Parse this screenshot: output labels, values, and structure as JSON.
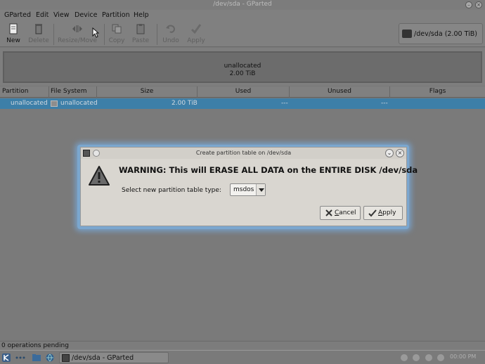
{
  "window": {
    "title": "/dev/sda - GParted"
  },
  "menubar": {
    "items": [
      {
        "label": "GParted"
      },
      {
        "label": "Edit"
      },
      {
        "label": "View"
      },
      {
        "label": "Device"
      },
      {
        "label": "Partition"
      },
      {
        "label": "Help"
      }
    ]
  },
  "toolbar": {
    "new_label": "New",
    "delete_label": "Delete",
    "resize_label": "Resize/Move",
    "copy_label": "Copy",
    "paste_label": "Paste",
    "undo_label": "Undo",
    "apply_label": "Apply",
    "device": "/dev/sda  (2.00 TiB)"
  },
  "disk_graphic": {
    "label": "unallocated",
    "size": "2.00 TiB"
  },
  "table": {
    "columns": [
      "Partition",
      "File System",
      "Size",
      "Used",
      "Unused",
      "Flags"
    ],
    "rows": [
      {
        "partition": "unallocated",
        "filesystem": "unallocated",
        "size": "2.00 TiB",
        "used": "---",
        "unused": "---",
        "flags": ""
      }
    ]
  },
  "status": {
    "text": "0 operations pending"
  },
  "taskbar": {
    "task_label": "/dev/sda - GParted",
    "clock": "00:00 PM"
  },
  "dialog": {
    "title": "Create partition table on /dev/sda",
    "warning": "WARNING:  This will ERASE ALL DATA on the ENTIRE DISK /dev/sda",
    "select_label": "Select new partition table type:",
    "table_type": "msdos",
    "cancel_prefix": "",
    "cancel_mnemonic": "C",
    "cancel_suffix": "ancel",
    "apply_prefix": "",
    "apply_mnemonic": "A",
    "apply_suffix": "pply"
  }
}
